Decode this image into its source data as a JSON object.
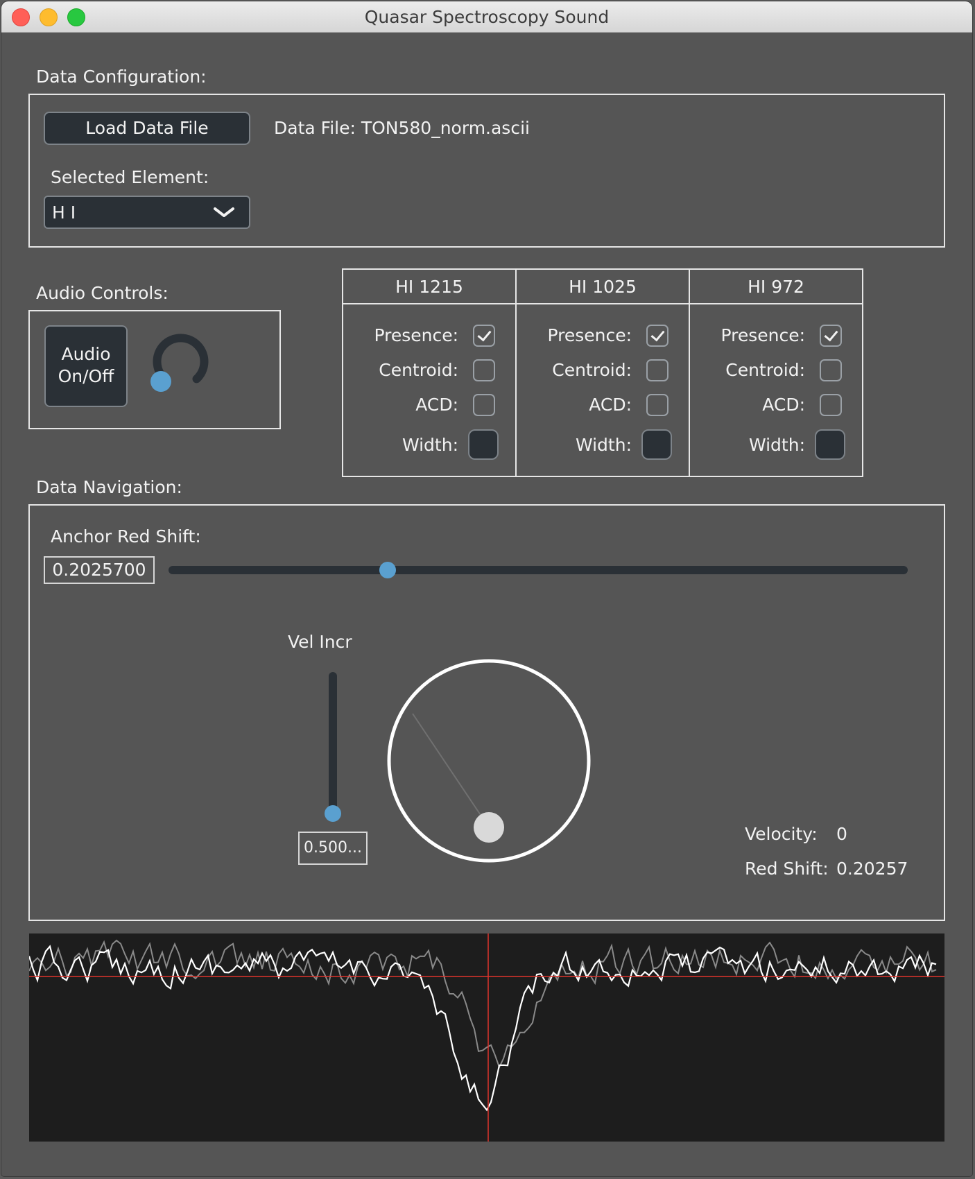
{
  "window": {
    "title": "Quasar Spectroscopy Sound"
  },
  "data_config": {
    "label": "Data Configuration:",
    "load_button": "Load Data File",
    "data_file_text": "Data File: TON580_norm.ascii",
    "selected_element_label": "Selected Element:",
    "selected_element_value": "H I"
  },
  "audio": {
    "label": "Audio Controls:",
    "toggle_line1": "Audio",
    "toggle_line2": "On/Off",
    "volume_level": 0.05
  },
  "lines": [
    {
      "name": "HI 1215",
      "presence": true,
      "centroid": false,
      "acd": false
    },
    {
      "name": "HI 1025",
      "presence": true,
      "centroid": false,
      "acd": false
    },
    {
      "name": "HI 972",
      "presence": true,
      "centroid": false,
      "acd": false
    }
  ],
  "line_row_labels": {
    "presence": "Presence:",
    "centroid": "Centroid:",
    "acd": "ACD:",
    "width": "Width:"
  },
  "navigation": {
    "label": "Data Navigation:",
    "anchor_label": "Anchor Red Shift:",
    "anchor_value": "0.2025700",
    "anchor_slider_fraction": 0.296,
    "vel_incr_label": "Vel Incr",
    "vel_incr_value": "0.500...",
    "vel_incr_fraction": 0.0,
    "velocity_label": "Velocity:",
    "velocity_value": "0",
    "redshift_label": "Red Shift:",
    "redshift_value": "0.20257"
  },
  "colors": {
    "accent": "#5aa0d0",
    "marker": "#e0342c",
    "control_bg": "#2a3036",
    "panel_bg": "#555555"
  }
}
